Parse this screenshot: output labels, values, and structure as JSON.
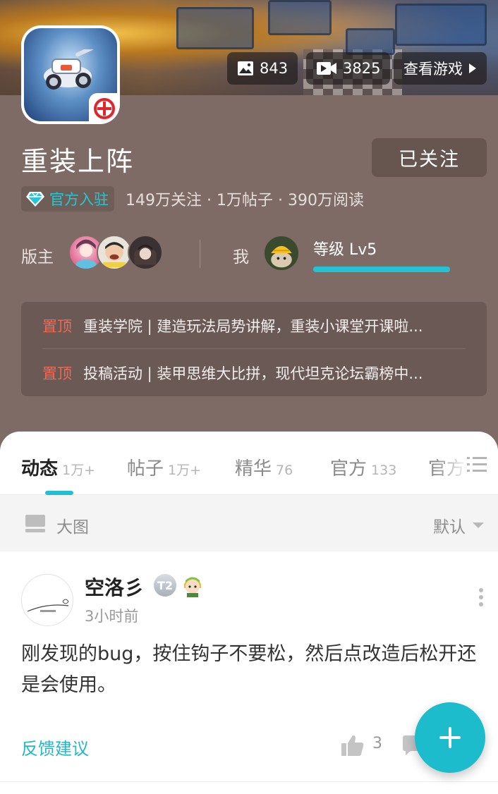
{
  "header": {
    "game_title": "重装上阵",
    "follow_label": "已关注",
    "image_count": "843",
    "video_count": "3825",
    "view_game_label": "查看游戏",
    "official_badge": "官方入驻",
    "stats_line": "149万关注 · 1万帖子 · 390万阅读",
    "moderators_label": "版主",
    "me_label": "我",
    "level_label": "等级 Lv5",
    "level_progress": 1.0,
    "icons": [
      "image-icon",
      "video-icon",
      "play-triangle-icon",
      "diamond-icon"
    ],
    "pinned": [
      {
        "tag": "置顶",
        "text": "重装学院 | 建造玩法局势讲解，重装小课堂开课啦..."
      },
      {
        "tag": "置顶",
        "text": "投稿活动 | 装甲思维大比拼，现代坦克论坛霸榜中..."
      }
    ]
  },
  "tabs": [
    {
      "label": "动态",
      "count": "1万+",
      "active": true
    },
    {
      "label": "帖子",
      "count": "1万+",
      "active": false
    },
    {
      "label": "精华",
      "count": "76",
      "active": false
    },
    {
      "label": "官方",
      "count": "133",
      "active": false
    },
    {
      "label": "官方",
      "count": "",
      "active": false
    }
  ],
  "view_bar": {
    "view_label": "大图",
    "sort_label": "默认"
  },
  "post": {
    "author": "空洛彡",
    "level_badge": "T2",
    "time": "3小时前",
    "body": "刚发现的bug，按住钩子不要松，然后点改造后松开还是会使用。",
    "tag": "反馈建议",
    "like_count": "3"
  },
  "colors": {
    "header_bg": "#7f6b65",
    "accent": "#1dbccc",
    "pinned_tag": "#ef6a53"
  }
}
